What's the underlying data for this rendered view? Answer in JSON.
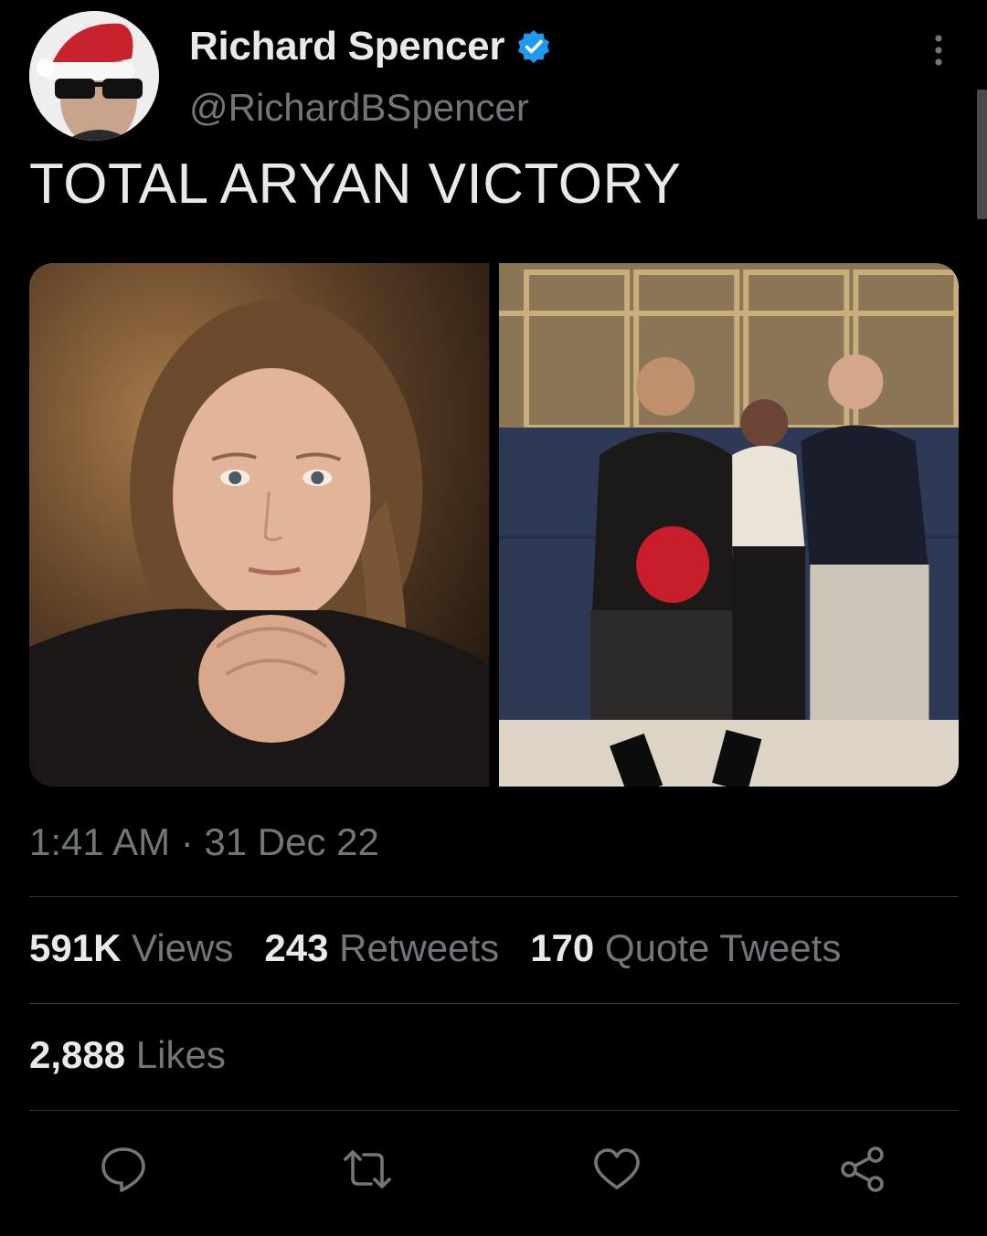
{
  "author": {
    "display_name": "Richard Spencer",
    "handle": "@RichardBSpencer",
    "verified": true,
    "verified_color": "#1d9bf0"
  },
  "tweet": {
    "text": "TOTAL ARYAN VICTORY",
    "timestamp": "1:41 AM · 31 Dec 22"
  },
  "media": [
    {
      "icon": "portrait-photo"
    },
    {
      "icon": "group-photo"
    }
  ],
  "stats": {
    "views_count": "591K",
    "views_label": "Views",
    "retweets_count": "243",
    "retweets_label": "Retweets",
    "quotes_count": "170",
    "quotes_label": "Quote Tweets",
    "likes_count": "2,888",
    "likes_label": "Likes"
  },
  "actions": [
    "reply-icon",
    "retweet-icon",
    "like-icon",
    "share-icon"
  ],
  "colors": {
    "background": "#000000",
    "text": "#e7e9ea",
    "secondary": "#71767b",
    "divider": "#2f3336"
  }
}
